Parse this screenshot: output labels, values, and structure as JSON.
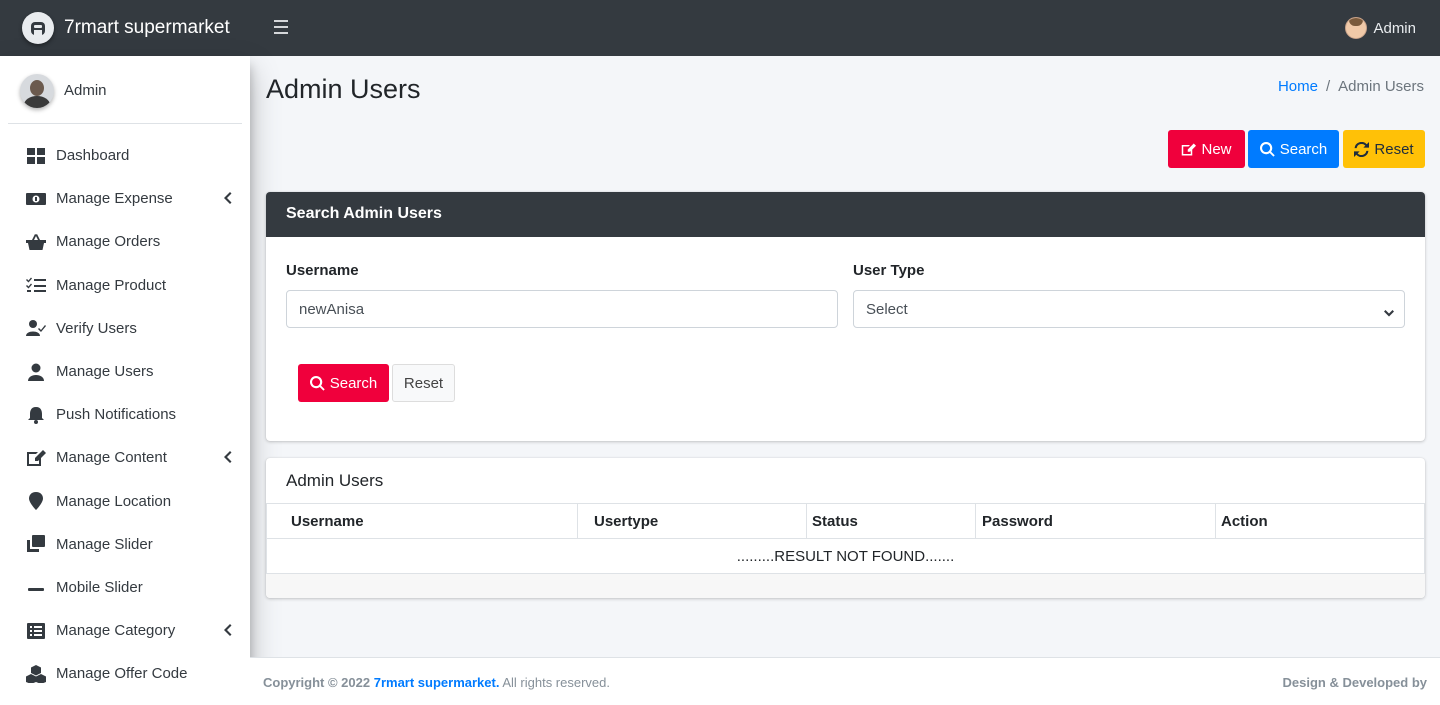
{
  "brand": {
    "name": "7rmart supermarket"
  },
  "sidebar": {
    "user_name": "Admin",
    "items": [
      {
        "label": "Dashboard",
        "icon": "dashboard-icon",
        "has_arrow": false
      },
      {
        "label": "Manage Expense",
        "icon": "money-bill-icon",
        "has_arrow": true
      },
      {
        "label": "Manage Orders",
        "icon": "basket-icon",
        "has_arrow": false
      },
      {
        "label": "Manage Product",
        "icon": "tasks-icon",
        "has_arrow": false
      },
      {
        "label": "Verify Users",
        "icon": "user-check-icon",
        "has_arrow": false
      },
      {
        "label": "Manage Users",
        "icon": "user-icon",
        "has_arrow": false
      },
      {
        "label": "Push Notifications",
        "icon": "bell-icon",
        "has_arrow": false
      },
      {
        "label": "Manage Content",
        "icon": "edit-icon",
        "has_arrow": true
      },
      {
        "label": "Manage Location",
        "icon": "map-marker-icon",
        "has_arrow": false
      },
      {
        "label": "Manage Slider",
        "icon": "clone-icon",
        "has_arrow": false
      },
      {
        "label": "Mobile Slider",
        "icon": "minus-icon",
        "has_arrow": false
      },
      {
        "label": "Manage Category",
        "icon": "list-alt-icon",
        "has_arrow": true
      },
      {
        "label": "Manage Offer Code",
        "icon": "cubes-icon",
        "has_arrow": false
      }
    ]
  },
  "topbar": {
    "user_name": "Admin"
  },
  "page": {
    "title": "Admin Users",
    "breadcrumb_home": "Home",
    "breadcrumb_sep": "/",
    "breadcrumb_current": "Admin Users"
  },
  "actions": {
    "new_label": "New",
    "search_label": "Search",
    "reset_label": "Reset"
  },
  "search_card": {
    "title": "Search Admin Users",
    "username_label": "Username",
    "username_value": "newAnisa",
    "usertype_label": "User Type",
    "usertype_value": "Select",
    "search_label": "Search",
    "reset_label": "Reset"
  },
  "table_card": {
    "title": "Admin Users",
    "columns": [
      "Username",
      "Usertype",
      "Status",
      "Password",
      "Action"
    ],
    "empty_message": ".........RESULT NOT FOUND......."
  },
  "footer": {
    "copyright_prefix": "Copyright © 2022 ",
    "copyright_brand": "7rmart supermarket.",
    "copyright_suffix": " All rights reserved.",
    "right_text": "Design & Developed by"
  },
  "colors": {
    "danger": "#f0003c",
    "primary": "#007bff",
    "warning": "#ffc107",
    "dark": "#343a40"
  }
}
